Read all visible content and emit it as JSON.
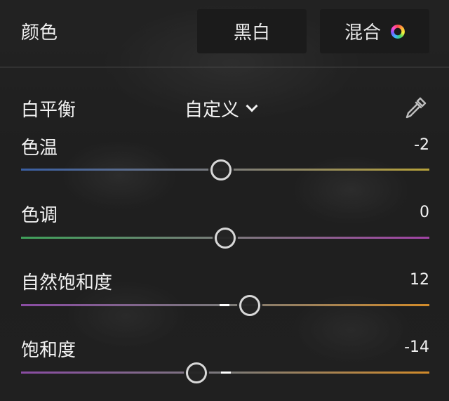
{
  "header": {
    "title": "颜色",
    "bw_button": "黑白",
    "mix_button": "混合",
    "mix_icon": "color-wheel-icon"
  },
  "white_balance": {
    "label": "白平衡",
    "preset": "自定义",
    "preset_icon": "chevron-down-icon",
    "picker_icon": "eyedropper-icon"
  },
  "sliders": [
    {
      "id": "temp",
      "label": "色温",
      "value": "-2",
      "level": 0.49,
      "gradient": [
        "#3a5fa3",
        "#b7a23a"
      ]
    },
    {
      "id": "tint",
      "label": "色调",
      "value": "0",
      "level": 0.5,
      "gradient": [
        "#3fa15a",
        "#a143a5"
      ]
    },
    {
      "id": "vibrance",
      "label": "自然饱和度",
      "value": "12",
      "level": 0.56,
      "gradient": [
        "#8a4ca3",
        "#d28b2a"
      ]
    },
    {
      "id": "saturation",
      "label": "饱和度",
      "value": "-14",
      "level": 0.43,
      "gradient": [
        "#8a4ca3",
        "#d28b2a"
      ]
    }
  ]
}
